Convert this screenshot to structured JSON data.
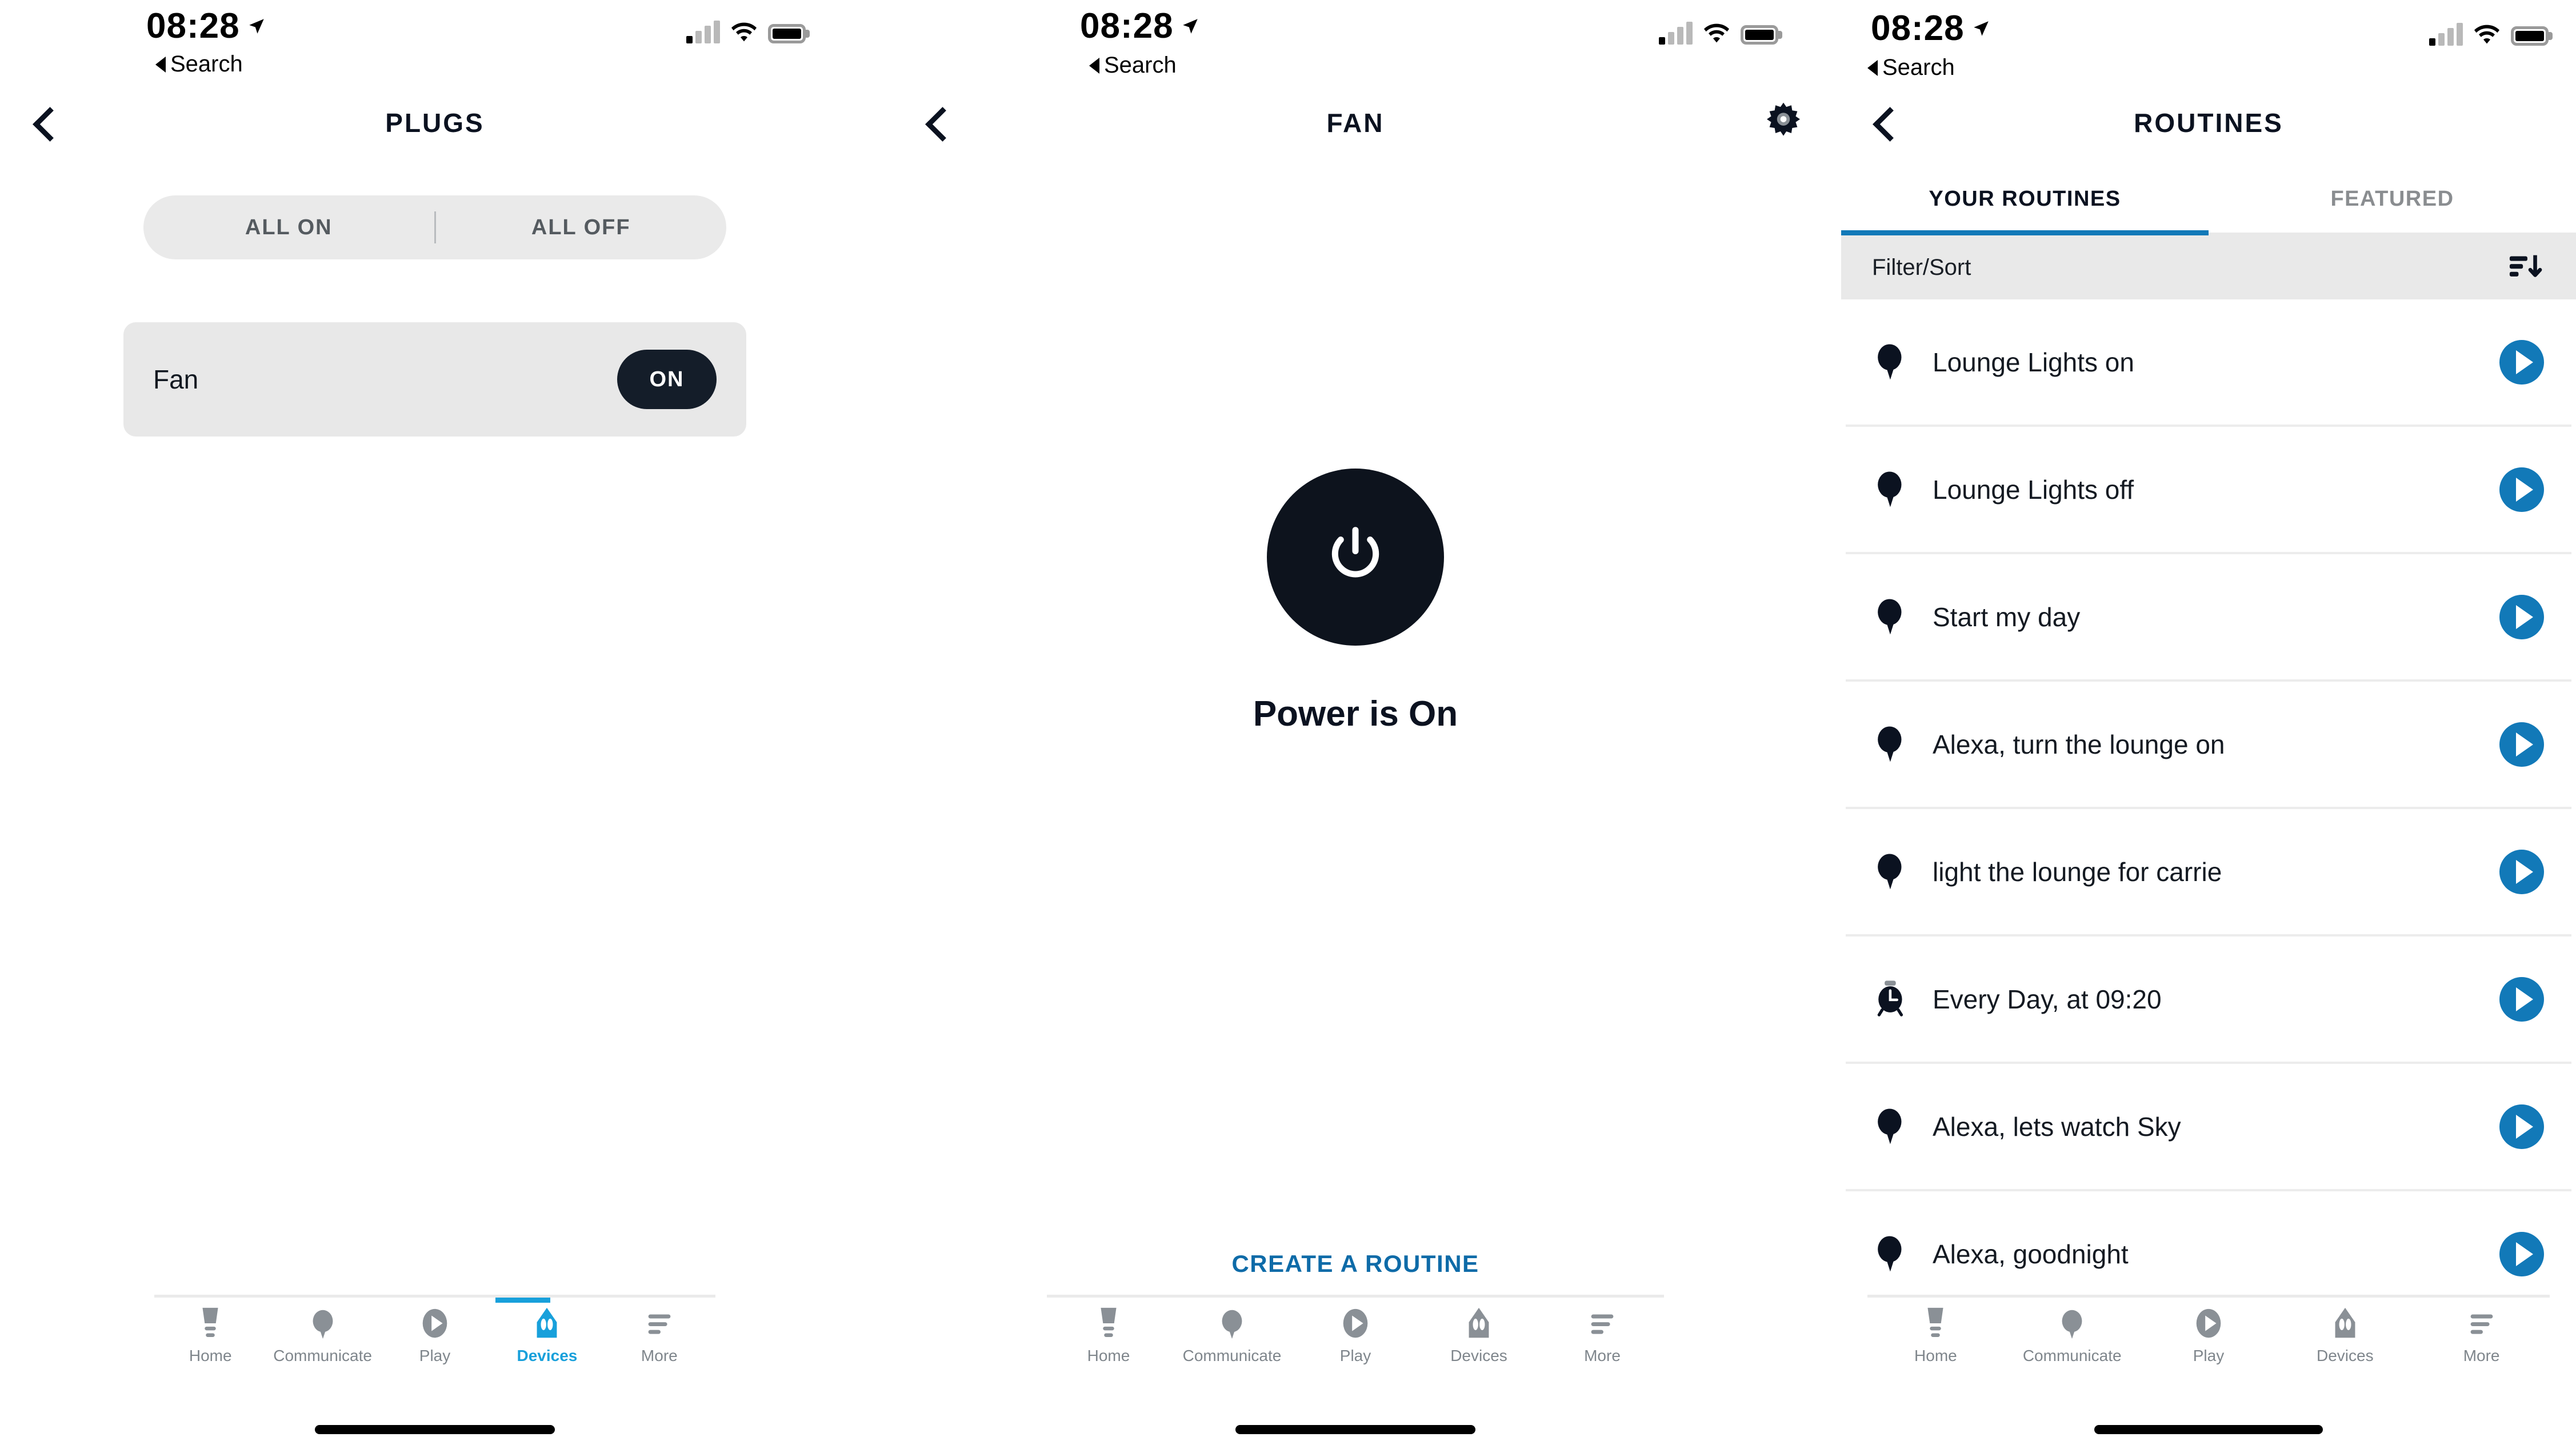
{
  "status_bar": {
    "time": "08:28",
    "back_label": "Search",
    "location_icon": "location-arrow-icon",
    "signal_icon": "cellular-signal-icon",
    "wifi_icon": "wifi-icon",
    "battery_icon": "battery-full-icon"
  },
  "colors": {
    "accent_blue": "#1279b8",
    "tab_active_blue": "#18a0db",
    "link_blue": "#0e6ba8",
    "dark": "#0d131d",
    "card_grey": "#e8e8e8",
    "segment_grey": "#eaeaea"
  },
  "tabbar": {
    "items": [
      {
        "label": "Home",
        "icon": "home-speaker-icon",
        "active": false
      },
      {
        "label": "Communicate",
        "icon": "speech-bubble-icon",
        "active": false
      },
      {
        "label": "Play",
        "icon": "play-circle-icon",
        "active": false
      },
      {
        "label": "Devices",
        "icon": "devices-icon",
        "active": false
      },
      {
        "label": "More",
        "icon": "more-lines-icon",
        "active": false
      }
    ],
    "items_plugs": [
      {
        "label": "Home",
        "icon": "home-speaker-icon",
        "active": false
      },
      {
        "label": "Communicate",
        "icon": "speech-bubble-icon",
        "active": false
      },
      {
        "label": "Play",
        "icon": "play-circle-icon",
        "active": false
      },
      {
        "label": "Devices",
        "icon": "devices-icon",
        "active": true
      },
      {
        "label": "More",
        "icon": "more-lines-icon",
        "active": false
      }
    ]
  },
  "screen_plugs": {
    "title": "PLUGS",
    "back_icon": "chevron-left-icon",
    "segmented": {
      "all_on": "ALL ON",
      "all_off": "ALL OFF"
    },
    "devices": [
      {
        "name": "Fan",
        "state": "ON"
      }
    ]
  },
  "screen_fan": {
    "title": "FAN",
    "back_icon": "chevron-left-icon",
    "settings_icon": "gear-icon",
    "power_icon": "power-icon",
    "power_status": "Power is On",
    "create_routine": "CREATE A ROUTINE"
  },
  "screen_routines": {
    "title": "ROUTINES",
    "back_icon": "chevron-left-icon",
    "add_icon": "plus-circle-icon",
    "tabs": [
      {
        "label": "YOUR ROUTINES",
        "active": true
      },
      {
        "label": "FEATURED",
        "active": false
      }
    ],
    "filter_sort": {
      "label": "Filter/Sort",
      "icon": "sort-descending-icon"
    },
    "routines": [
      {
        "label": "Lounge Lights on",
        "icon": "speech-bubble-icon",
        "action_icon": "play-icon"
      },
      {
        "label": "Lounge Lights off",
        "icon": "speech-bubble-icon",
        "action_icon": "play-icon"
      },
      {
        "label": "Start my day",
        "icon": "speech-bubble-icon",
        "action_icon": "play-icon"
      },
      {
        "label": "Alexa, turn the lounge on",
        "icon": "speech-bubble-icon",
        "action_icon": "play-icon"
      },
      {
        "label": "light the lounge for carrie",
        "icon": "speech-bubble-icon",
        "action_icon": "play-icon"
      },
      {
        "label": "Every Day, at 09:20",
        "icon": "alarm-clock-icon",
        "action_icon": "play-icon"
      },
      {
        "label": "Alexa, lets watch Sky",
        "icon": "speech-bubble-icon",
        "action_icon": "play-icon"
      },
      {
        "label": "Alexa, goodnight",
        "icon": "speech-bubble-icon",
        "action_icon": "play-icon"
      }
    ]
  }
}
